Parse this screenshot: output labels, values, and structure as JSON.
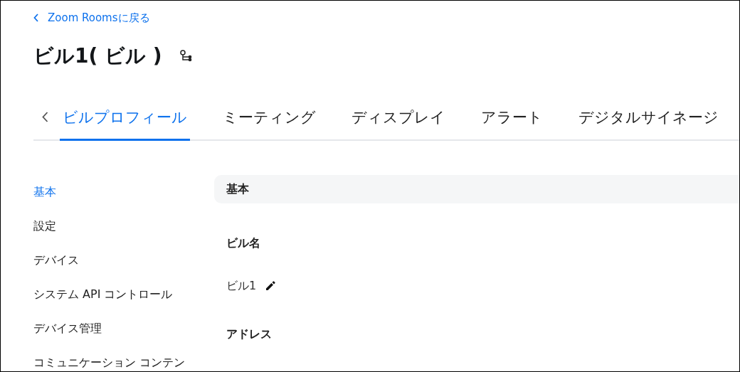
{
  "back_link": {
    "label": "Zoom Roomsに戻る"
  },
  "title": "ビル1( ビル )",
  "tabs": [
    {
      "label": "ビルプロフィール",
      "selected": true
    },
    {
      "label": "ミーティング",
      "selected": false
    },
    {
      "label": "ディスプレイ",
      "selected": false
    },
    {
      "label": "アラート",
      "selected": false
    },
    {
      "label": "デジタルサイネージ",
      "selected": false
    }
  ],
  "sidebar": {
    "items": [
      {
        "label": "基本",
        "selected": true
      },
      {
        "label": "設定",
        "selected": false
      },
      {
        "label": "デバイス",
        "selected": false
      },
      {
        "label": "システム API コントロール",
        "selected": false
      },
      {
        "label": "デバイス管理",
        "selected": false
      },
      {
        "label": "コミュニケーション コンテン",
        "selected": false
      }
    ]
  },
  "section": {
    "header": "基本",
    "fields": [
      {
        "label": "ビル名",
        "value": "ビル1",
        "editable": true
      },
      {
        "label": "アドレス"
      }
    ]
  }
}
